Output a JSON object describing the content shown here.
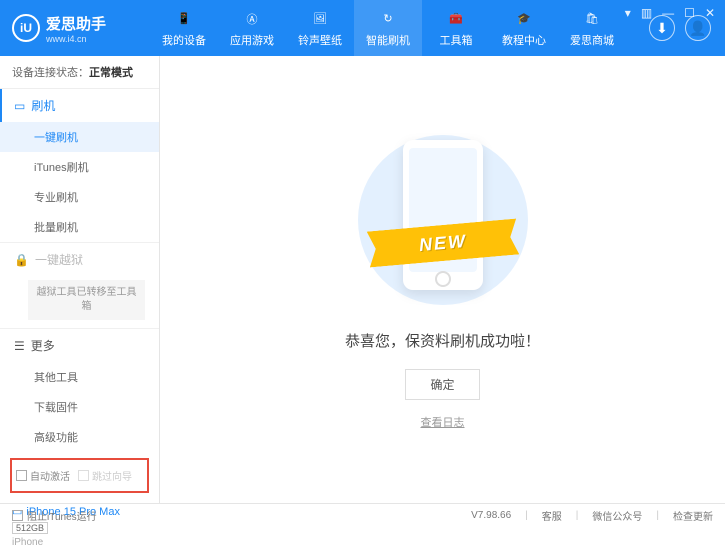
{
  "header": {
    "logo_char": "iU",
    "app_name": "爱思助手",
    "app_url": "www.i4.cn",
    "win": {
      "menu": "▾",
      "skin": "▥",
      "min": "—",
      "max": "☐",
      "close": "✕"
    }
  },
  "nav": [
    {
      "label": "我的设备",
      "icon": "📱"
    },
    {
      "label": "应用游戏",
      "icon": "Ⓐ"
    },
    {
      "label": "铃声壁纸",
      "icon": "🖼"
    },
    {
      "label": "智能刷机",
      "icon": "↻",
      "active": true
    },
    {
      "label": "工具箱",
      "icon": "🧰"
    },
    {
      "label": "教程中心",
      "icon": "🎓"
    },
    {
      "label": "爱思商城",
      "icon": "🛍"
    }
  ],
  "user_icons": {
    "download": "⬇",
    "profile": "👤"
  },
  "sidebar": {
    "conn_label": "设备连接状态：",
    "conn_value": "正常模式",
    "flash": {
      "title": "刷机",
      "items": [
        {
          "label": "一键刷机",
          "active": true
        },
        {
          "label": "iTunes刷机"
        },
        {
          "label": "专业刷机"
        },
        {
          "label": "批量刷机"
        }
      ]
    },
    "jailbreak": {
      "title": "一键越狱",
      "note": "越狱工具已转移至工具箱"
    },
    "more": {
      "title": "更多",
      "items": [
        {
          "label": "其他工具"
        },
        {
          "label": "下载固件"
        },
        {
          "label": "高级功能"
        }
      ]
    },
    "checkboxes": {
      "auto_activate": "自动激活",
      "skip_guide": "跳过向导"
    },
    "device": {
      "name": "iPhone 15 Pro Max",
      "storage": "512GB",
      "type": "iPhone"
    }
  },
  "main": {
    "ribbon": "NEW",
    "success": "恭喜您，保资料刷机成功啦！",
    "confirm": "确定",
    "view_log": "查看日志"
  },
  "statusbar": {
    "block_itunes": "阻止iTunes运行",
    "version": "V7.98.66",
    "links": {
      "support": "客服",
      "wechat": "微信公众号",
      "update": "检查更新"
    }
  }
}
